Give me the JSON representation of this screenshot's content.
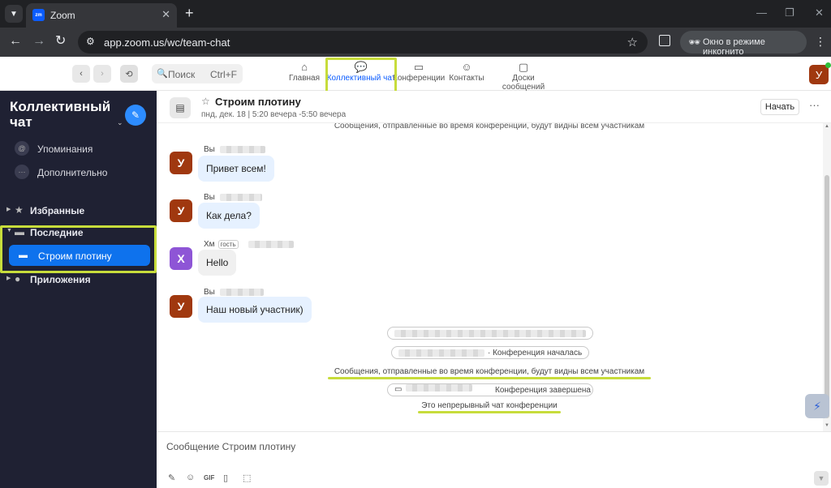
{
  "browser": {
    "tab_title": "Zoom",
    "favicon_text": "zm",
    "url": "app.zoom.us/wc/team-chat",
    "incognito_label": "Окно в режиме инкогнито"
  },
  "header": {
    "search_label": "Поиск",
    "search_shortcut": "Ctrl+F",
    "tabs": [
      {
        "label": "Главная",
        "icon": "home-icon"
      },
      {
        "label": "Коллективный чат",
        "icon": "chat-icon"
      },
      {
        "label": "Конференции",
        "icon": "video-icon"
      },
      {
        "label": "Контакты",
        "icon": "contacts-icon"
      },
      {
        "label": "Доски сообщений",
        "icon": "whiteboard-icon"
      }
    ],
    "active_tab": "Коллективный чат",
    "user_initial": "У"
  },
  "sidebar": {
    "title": "Коллективный чат",
    "items": [
      {
        "label": "Упоминания",
        "icon": "at-icon"
      },
      {
        "label": "Дополнительно",
        "icon": "more-icon"
      }
    ],
    "groups": {
      "favorites": "Избранные",
      "recent": "Последние",
      "apps": "Приложения"
    },
    "active_channel": "Строим плотину"
  },
  "chat": {
    "channel_name": "Строим плотину",
    "meta": "пнд, дек. 18  |  5:20 вечера -5:50 вечера",
    "start_label": "Начать",
    "top_notice": "Сообщения, отправленные во время конференции, будут видны всем участникам",
    "messages": [
      {
        "sender": "Вы",
        "avatar": "У",
        "text": "Привет всем!"
      },
      {
        "sender": "Вы",
        "avatar": "У",
        "text": "Как дела?"
      },
      {
        "sender": "Хм",
        "avatar": "Х",
        "badge": "гость",
        "text": "Hello"
      },
      {
        "sender": "Вы",
        "avatar": "У",
        "text": "Наш новый участник)"
      }
    ],
    "events": {
      "conference_started": "· Конференция началась",
      "visible_notice": "Сообщения, отправленные во время конференции, будут видны всем участникам",
      "conference_ended": "Конференция завершена",
      "continuous_chat": "Это непрерывный чат конференции"
    },
    "composer_placeholder": "Сообщение Строим плотину"
  },
  "colors": {
    "accent": "#0b5cff",
    "sidebar_bg": "#1f2133",
    "highlight": "#c7dc3b",
    "avatar_self": "#a0380f",
    "avatar_guest": "#8e55d6"
  }
}
